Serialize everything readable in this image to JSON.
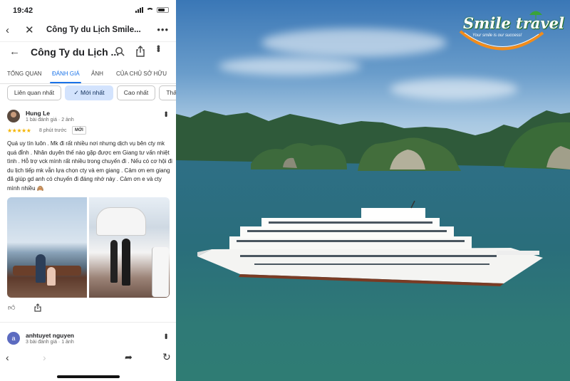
{
  "status_bar": {
    "time": "19:42"
  },
  "app_bar": {
    "title": "Công Ty du Lịch Smile...",
    "more_label": "•••"
  },
  "place_header": {
    "title": "Công Ty du Lịch ..."
  },
  "tabs": [
    {
      "label": "TỔNG QUAN",
      "active": false
    },
    {
      "label": "ĐÁNH GIÁ",
      "active": true
    },
    {
      "label": "ẢNH",
      "active": false
    },
    {
      "label": "CỦA CHỦ SỞ HỮU",
      "active": false
    }
  ],
  "filter_chips": [
    {
      "label": "Liên quan nhất",
      "selected": false
    },
    {
      "label": "✓ Mới nhất",
      "selected": true
    },
    {
      "label": "Cao nhất",
      "selected": false
    },
    {
      "label": "Thấp",
      "selected": false
    }
  ],
  "review": {
    "author": "Hung Le",
    "meta": "1 bài đánh giá · 2 ảnh",
    "stars": "★★★★★",
    "rating": 5,
    "time": "8 phút trước",
    "badge": "MỚI",
    "text": "Quá uy tín luôn . Mk đi rất nhiều nơi nhưng dịch vụ bên cty mk quá đỉnh . Nhân duyên thế nào gặp được em Giang tư vấn nhiệt tình . Hỗ trợ vck mình rất nhiều trong chuyến đi . Nếu có cơ hội đi du lịch tiếp mk vẫn lựa chọn cty và em giang . Cảm ơn em giang đã giúp gd anh có chuyến đi đáng nhớ này . Cảm ơn e và cty mình nhiều 🙈"
  },
  "review2": {
    "avatar_letter": "a",
    "author": "anhtuyet nguyen",
    "meta": "3 bài đánh giá · 1 ảnh"
  },
  "logo": {
    "brand": "Smile travel",
    "tagline": "Your smile is our success!"
  },
  "colors": {
    "accent": "#1a73e8",
    "stars": "#f5b400",
    "chip_selected": "#d3e3fd"
  },
  "icons": [
    "back-arrow-icon",
    "close-icon",
    "search-icon",
    "share-icon",
    "more-icon",
    "like-icon",
    "umbrella-icon"
  ]
}
